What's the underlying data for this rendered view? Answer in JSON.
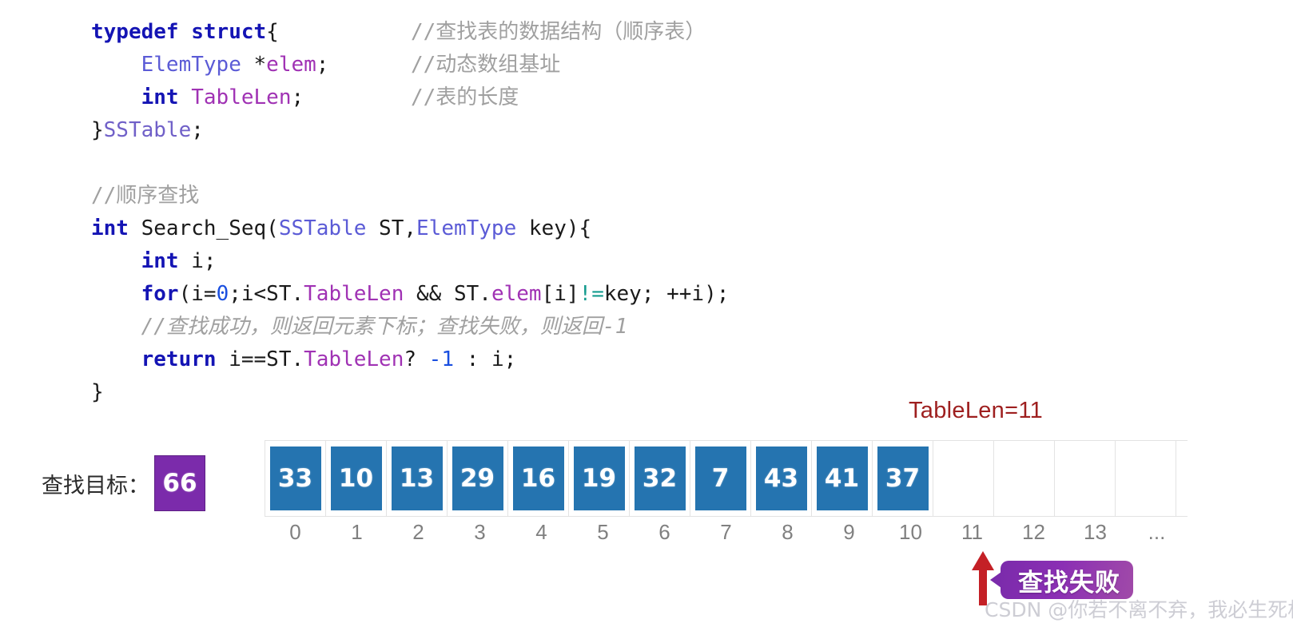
{
  "code": {
    "lines": [
      {
        "tokens": [
          {
            "t": "typedef ",
            "c": "kw"
          },
          {
            "t": "struct",
            "c": "kw"
          },
          {
            "t": "{",
            "c": "plain"
          }
        ],
        "comment": "//查找表的数据结构（顺序表）"
      },
      {
        "tokens": [
          {
            "t": "    ",
            "c": "plain"
          },
          {
            "t": "ElemType",
            "c": "type-lt"
          },
          {
            "t": " *",
            "c": "plain"
          },
          {
            "t": "elem",
            "c": "member"
          },
          {
            "t": ";",
            "c": "plain"
          }
        ],
        "comment": "//动态数组基址"
      },
      {
        "tokens": [
          {
            "t": "    ",
            "c": "plain"
          },
          {
            "t": "int",
            "c": "kw"
          },
          {
            "t": " ",
            "c": "plain"
          },
          {
            "t": "TableLen",
            "c": "member"
          },
          {
            "t": ";",
            "c": "plain"
          }
        ],
        "comment": "//表的长度"
      },
      {
        "tokens": [
          {
            "t": "}",
            "c": "plain"
          },
          {
            "t": "SSTable",
            "c": "sstable-name"
          },
          {
            "t": ";",
            "c": "plain"
          }
        ],
        "comment": ""
      },
      {
        "tokens": [],
        "comment": ""
      },
      {
        "tokens": [
          {
            "t": "//顺序查找",
            "c": "comment"
          }
        ],
        "comment": ""
      },
      {
        "tokens": [
          {
            "t": "int",
            "c": "kw"
          },
          {
            "t": " Search_Seq(",
            "c": "plain"
          },
          {
            "t": "SSTable",
            "c": "type-lt"
          },
          {
            "t": " ST,",
            "c": "plain"
          },
          {
            "t": "ElemType",
            "c": "type-lt"
          },
          {
            "t": " key){",
            "c": "plain"
          }
        ],
        "comment": ""
      },
      {
        "tokens": [
          {
            "t": "    ",
            "c": "plain"
          },
          {
            "t": "int",
            "c": "kw"
          },
          {
            "t": " i;",
            "c": "plain"
          }
        ],
        "comment": ""
      },
      {
        "tokens": [
          {
            "t": "    ",
            "c": "plain"
          },
          {
            "t": "for",
            "c": "kw"
          },
          {
            "t": "(i=",
            "c": "plain"
          },
          {
            "t": "0",
            "c": "num"
          },
          {
            "t": ";i<ST.",
            "c": "plain"
          },
          {
            "t": "TableLen",
            "c": "member"
          },
          {
            "t": " && ST.",
            "c": "plain"
          },
          {
            "t": "elem",
            "c": "member"
          },
          {
            "t": "[i]",
            "c": "plain"
          },
          {
            "t": "!=",
            "c": "op-neq"
          },
          {
            "t": "key; ++i);",
            "c": "plain"
          }
        ],
        "comment": ""
      },
      {
        "tokens": [
          {
            "t": "    ",
            "c": "plain"
          },
          {
            "t": "//查找成功，则返回元素下标；查找失败，则返回-1",
            "c": "comment-i"
          }
        ],
        "comment": ""
      },
      {
        "tokens": [
          {
            "t": "    ",
            "c": "plain"
          },
          {
            "t": "return",
            "c": "kw"
          },
          {
            "t": " i==ST.",
            "c": "plain"
          },
          {
            "t": "TableLen",
            "c": "member"
          },
          {
            "t": "? ",
            "c": "plain"
          },
          {
            "t": "-1",
            "c": "num"
          },
          {
            "t": " : i;",
            "c": "plain"
          }
        ],
        "comment": ""
      },
      {
        "tokens": [
          {
            "t": "}",
            "c": "plain"
          }
        ],
        "comment": ""
      }
    ]
  },
  "diagram": {
    "tablelen_label": "TableLen=11",
    "search_target_label": "查找目标：",
    "search_target_value": "66",
    "array_values": [
      "33",
      "10",
      "13",
      "29",
      "16",
      "19",
      "32",
      "7",
      "43",
      "41",
      "37"
    ],
    "empty_cells": 4,
    "indices": [
      "0",
      "1",
      "2",
      "3",
      "4",
      "5",
      "6",
      "7",
      "8",
      "9",
      "10",
      "11",
      "12",
      "13",
      "..."
    ],
    "fail_callout_text": "查找失败",
    "arrow_target_index": "11"
  },
  "watermark": {
    "text": "CSDN @你若不离不弃，我必生死相依"
  },
  "colors": {
    "array_fill": "#2574b0",
    "target_box": "#7b2bab",
    "tablelen_text": "#9e1f1f",
    "arrow": "#c42026",
    "callout": "#7b2bab",
    "index_label": "#808080",
    "comment": "#a0a0a0",
    "keyword": "#1414b4",
    "member": "#a032b4"
  }
}
